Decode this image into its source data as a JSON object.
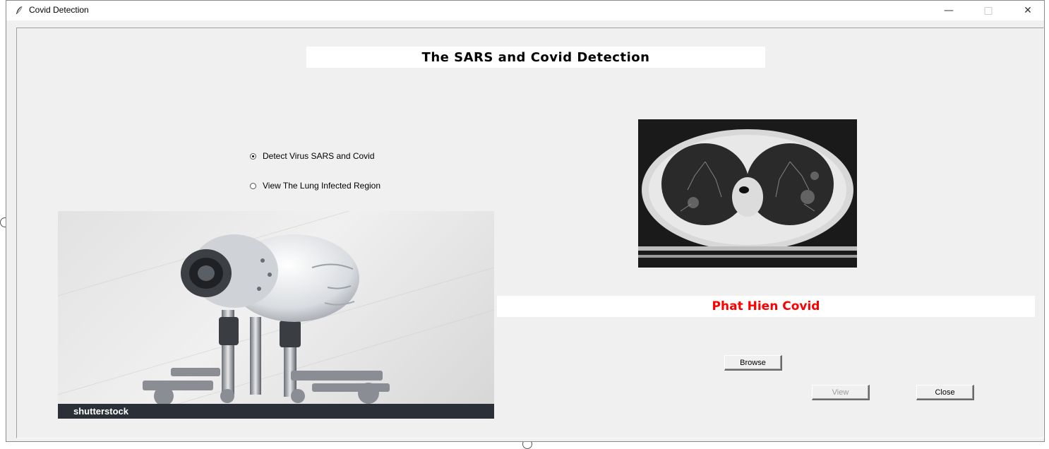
{
  "window": {
    "title": "Covid Detection",
    "minimize_glyph": "—",
    "maximize_glyph": "□",
    "close_glyph": "✕"
  },
  "heading": "The SARS and Covid Detection",
  "options": [
    {
      "label": "Detect Virus SARS and Covid",
      "selected": true
    },
    {
      "label": "View The Lung Infected Region",
      "selected": false
    }
  ],
  "robot_image": {
    "brand": "shutterstock",
    "watermark": "shutterstock"
  },
  "result": {
    "text": "Phat Hien Covid",
    "color": "#ff0000"
  },
  "buttons": {
    "browse": "Browse",
    "view": "View",
    "close": "Close"
  },
  "icons": {
    "app": "feather-icon",
    "minimize": "minimize-icon",
    "maximize": "maximize-icon",
    "close": "close-icon"
  }
}
